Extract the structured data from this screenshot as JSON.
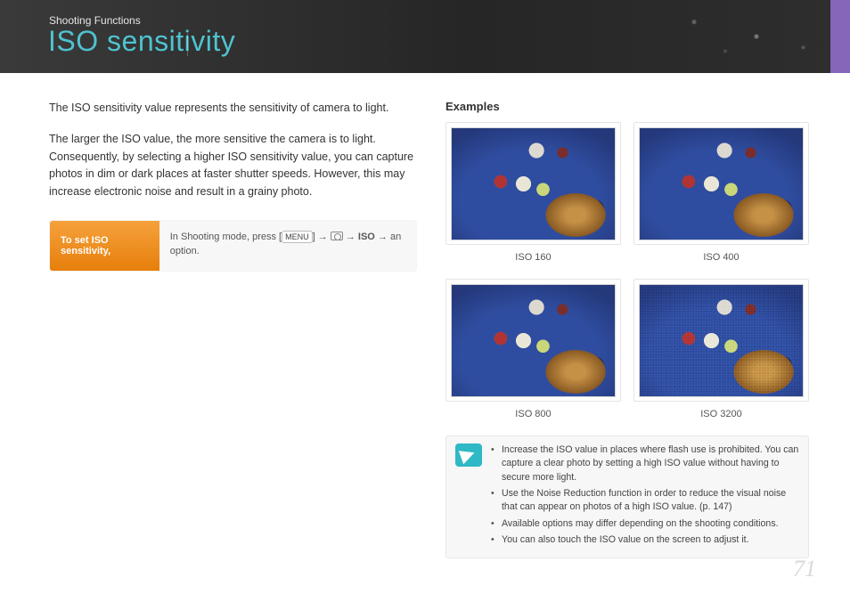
{
  "header": {
    "breadcrumb": "Shooting Functions",
    "title": "ISO sensitivity"
  },
  "intro": {
    "p1": "The ISO sensitivity value represents the sensitivity of camera to light.",
    "p2": "The larger the ISO value, the more sensitive the camera is to light. Consequently, by selecting a higher ISO sensitivity value, you can capture photos in dim or dark places at faster shutter speeds. However, this may increase electronic noise and result in a grainy photo."
  },
  "howto": {
    "label": "To set ISO sensitivity,",
    "prefix": "In Shooting mode, press [",
    "menu": "MENU",
    "mid1": "] → ",
    "iso": "ISO",
    "tail": " → an option."
  },
  "examples": {
    "heading": "Examples",
    "items": [
      {
        "caption": "ISO 160"
      },
      {
        "caption": "ISO 400"
      },
      {
        "caption": "ISO 800"
      },
      {
        "caption": "ISO 3200"
      }
    ]
  },
  "notes": {
    "items": [
      "Increase the ISO value in places where flash use is prohibited. You can capture a clear photo by setting a high ISO value without having to secure more light.",
      "Use the Noise Reduction function in order to reduce the visual noise that can appear on photos of a high ISO value. (p. 147)",
      "Available options may differ depending on the shooting conditions.",
      "You can also touch the ISO value on the screen to adjust it."
    ]
  },
  "page_number": "71"
}
